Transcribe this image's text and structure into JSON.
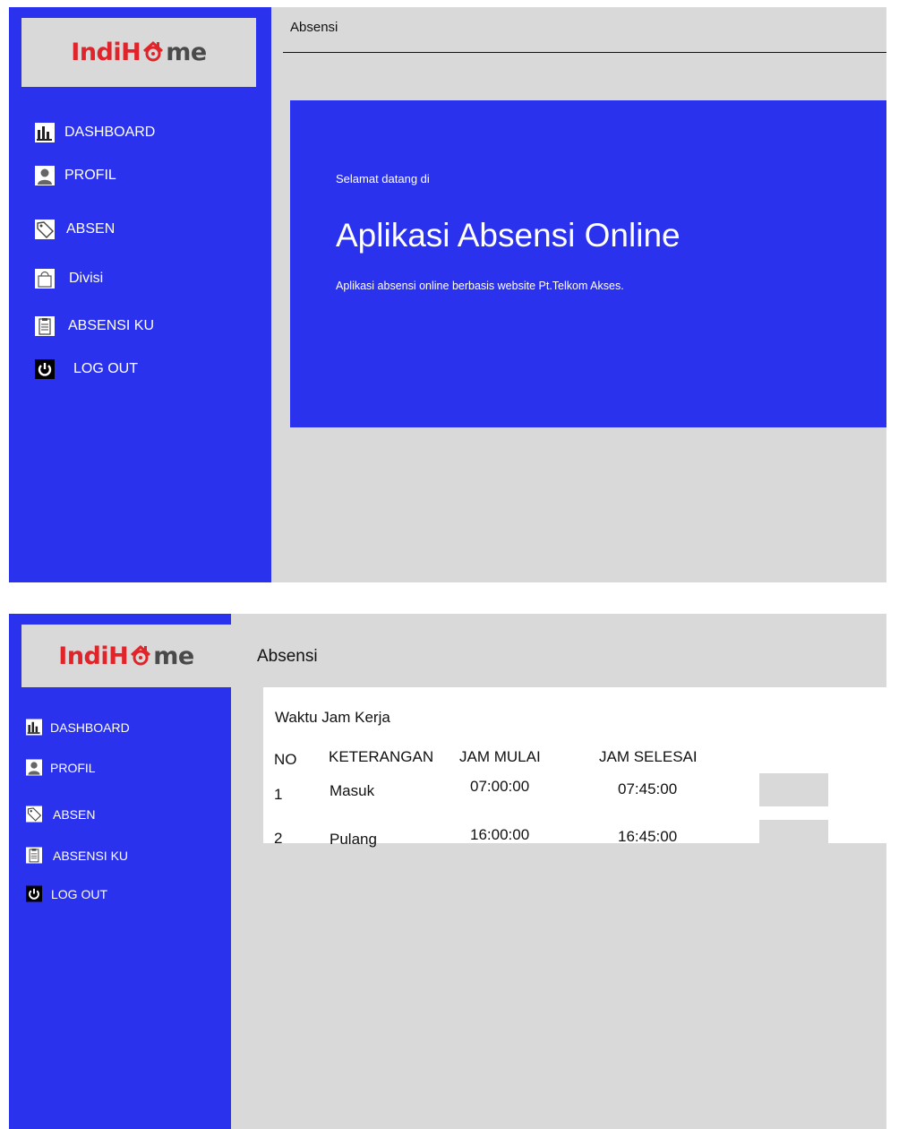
{
  "logo": {
    "part1": "Indi",
    "part2": "H",
    "part3": "me"
  },
  "colors": {
    "sidebar": "#2b32ee",
    "hero": "#2b32ee",
    "background": "#d9d9d9",
    "logo_red": "#e0242a",
    "logo_gray": "#4a4a4a"
  },
  "screen1": {
    "page_title": "Absensi",
    "nav": [
      {
        "label": "DASHBOARD",
        "icon": "bar-chart-icon"
      },
      {
        "label": "PROFIL",
        "icon": "user-icon"
      },
      {
        "label": "ABSEN",
        "icon": "tag-icon"
      },
      {
        "label": "Divisi",
        "icon": "bag-icon"
      },
      {
        "label": "ABSENSI KU",
        "icon": "clipboard-icon"
      },
      {
        "label": "LOG OUT",
        "icon": "power-icon"
      }
    ],
    "hero": {
      "intro": "Selamat datang di",
      "title": "Aplikasi Absensi Online",
      "description": "Aplikasi absensi online berbasis website Pt.Telkom Akses."
    }
  },
  "screen2": {
    "page_title": "Absensi",
    "nav": [
      {
        "label": "DASHBOARD",
        "icon": "bar-chart-icon"
      },
      {
        "label": "PROFIL",
        "icon": "user-icon"
      },
      {
        "label": "ABSEN",
        "icon": "tag-icon"
      },
      {
        "label": "ABSENSI KU",
        "icon": "clipboard-icon"
      },
      {
        "label": "LOG OUT",
        "icon": "power-icon"
      }
    ],
    "card": {
      "title": "Waktu Jam Kerja",
      "columns": [
        "NO",
        "KETERANGAN",
        "JAM MULAI",
        "JAM SELESAI"
      ],
      "rows": [
        {
          "no": "1",
          "keterangan": "Masuk",
          "jam_mulai": "07:00:00",
          "jam_selesai": "07:45:00"
        },
        {
          "no": "2",
          "keterangan": "Pulang",
          "jam_mulai": "16:00:00",
          "jam_selesai": "16:45:00"
        }
      ]
    }
  }
}
